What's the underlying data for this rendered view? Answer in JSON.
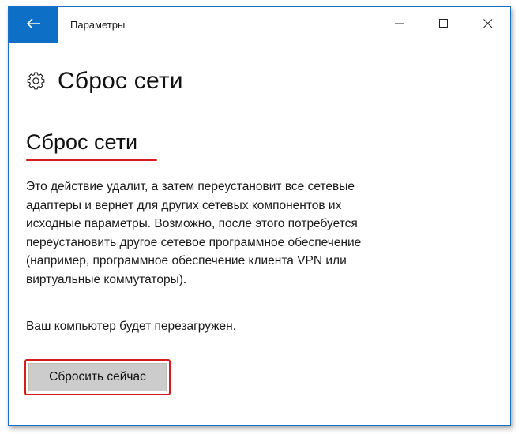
{
  "window": {
    "app_title": "Параметры"
  },
  "header": {
    "page_title": "Сброс сети"
  },
  "section": {
    "title": "Сброс сети",
    "description_lines": [
      "Это действие удалит, а затем переустановит все сетевые",
      "адаптеры и вернет для других сетевых компонентов их",
      "исходные параметры. Возможно, после этого потребуется",
      "переустановить другое сетевое программное обеспечение",
      "(например, программное обеспечение клиента VPN или",
      "виртуальные коммутаторы)."
    ],
    "restart_note": "Ваш компьютер будет перезагружен.",
    "reset_button_label": "Сбросить сейчас"
  },
  "icons": {
    "back": "back-arrow-icon",
    "minimize": "minimize-icon",
    "maximize": "maximize-icon",
    "close": "close-icon",
    "settings": "gear-icon"
  },
  "colors": {
    "accent": "#0e6fc7",
    "highlight": "#d41c1c",
    "button_bg": "#cccccc"
  }
}
